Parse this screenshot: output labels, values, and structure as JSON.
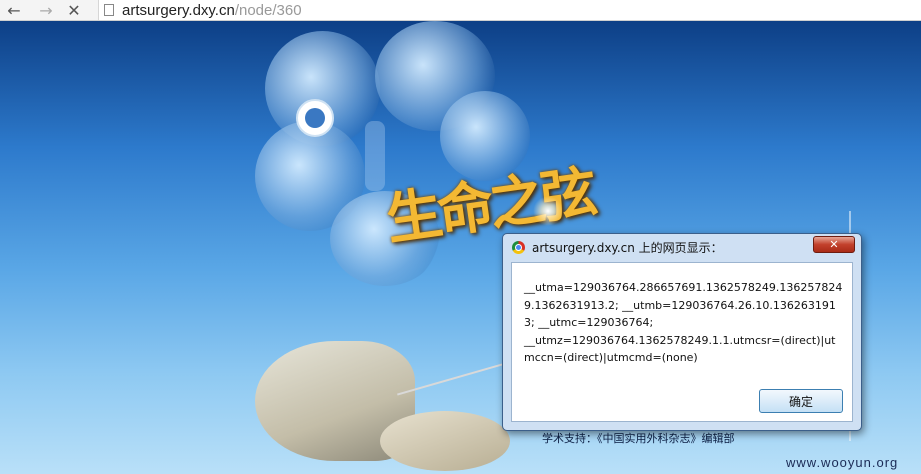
{
  "browser": {
    "back_icon": "←",
    "forward_icon": "→",
    "stop_icon": "✕",
    "url_host": "artsurgery.dxy.cn",
    "url_path": "/node/360"
  },
  "page": {
    "calligraphy": "生命之弦",
    "footer": "学术支持：《中国实用外科杂志》编辑部",
    "watermark": "www.wooyun.org"
  },
  "dialog": {
    "title": "artsurgery.dxy.cn 上的网页显示：",
    "message": "__utma=129036764.286657691.1362578249.1362578249.1362631913.2; __utmb=129036764.26.10.1362631913; __utmc=129036764;\n__utmz=129036764.1362578249.1.1.utmcsr=(direct)|utmccn=(direct)|utmcmd=(none)",
    "close_label": "✕",
    "ok_label": "确定"
  },
  "colors": {
    "accent": "#2d7acc",
    "dialog_frame": "#cfe0f3",
    "close_red": "#c2412c"
  }
}
